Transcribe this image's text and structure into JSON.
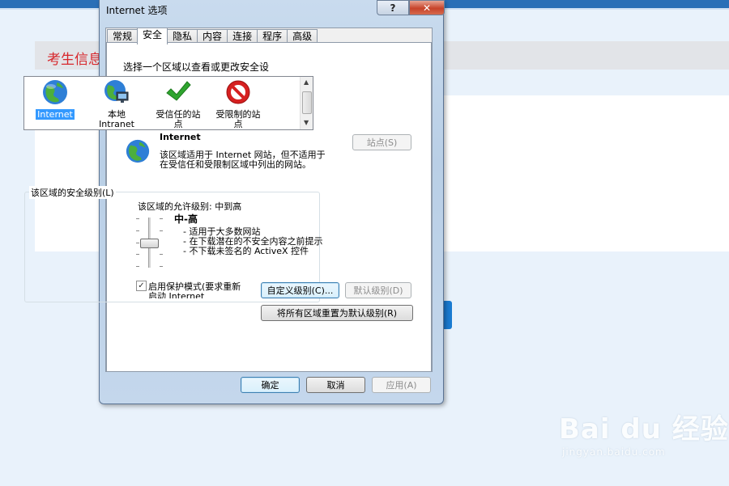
{
  "background": {
    "header_text": "考生信息",
    "watermark_logo": "Bai du 经验",
    "watermark_sub": "jingyan.baidu.com"
  },
  "dialog": {
    "title": "Internet 选项",
    "help_button": "?",
    "close_button": "✕",
    "tabs": [
      {
        "label": "常规",
        "active": false
      },
      {
        "label": "安全",
        "active": true
      },
      {
        "label": "隐私",
        "active": false
      },
      {
        "label": "内容",
        "active": false
      },
      {
        "label": "连接",
        "active": false
      },
      {
        "label": "程序",
        "active": false
      },
      {
        "label": "高级",
        "active": false
      }
    ],
    "zone_prompt": "选择一个区域以查看或更改安全设",
    "zones": [
      {
        "label": "Internet",
        "icon": "globe-icon",
        "selected": true
      },
      {
        "label": "本地 Intranet",
        "icon": "local-intranet-icon",
        "selected": false
      },
      {
        "label": "受信任的站点",
        "icon": "checkmark-icon",
        "selected": false
      },
      {
        "label": "受限制的站点",
        "icon": "no-entry-icon",
        "selected": false
      }
    ],
    "zone_info": {
      "name": "Internet",
      "description_line1": "该区域适用于 Internet 网站，但不适用于",
      "description_line2": "在受信任和受限制区域中列出的网站。",
      "sites_button": "站点(S)"
    },
    "security_level": {
      "group_title": "该区域的安全级别(L)",
      "allowed_levels": "该区域的允许级别: 中到高",
      "level_name": "中-高",
      "bullets": [
        "- 适用于大多数网站",
        "- 在下载潜在的不安全内容之前提示",
        "- 不下载未签名的 ActiveX 控件"
      ],
      "slider_level": "中-高",
      "protected_mode_checked": true,
      "protected_mode_line1": "启用保护模式(要求重新",
      "protected_mode_line2": "启动 Internet",
      "custom_level_button": "自定义级别(C)...",
      "default_level_button": "默认级别(D)"
    },
    "reset_all_button": "将所有区域重置为默认级别(R)",
    "footer": {
      "ok": "确定",
      "cancel": "取消",
      "apply": "应用(A)"
    }
  }
}
